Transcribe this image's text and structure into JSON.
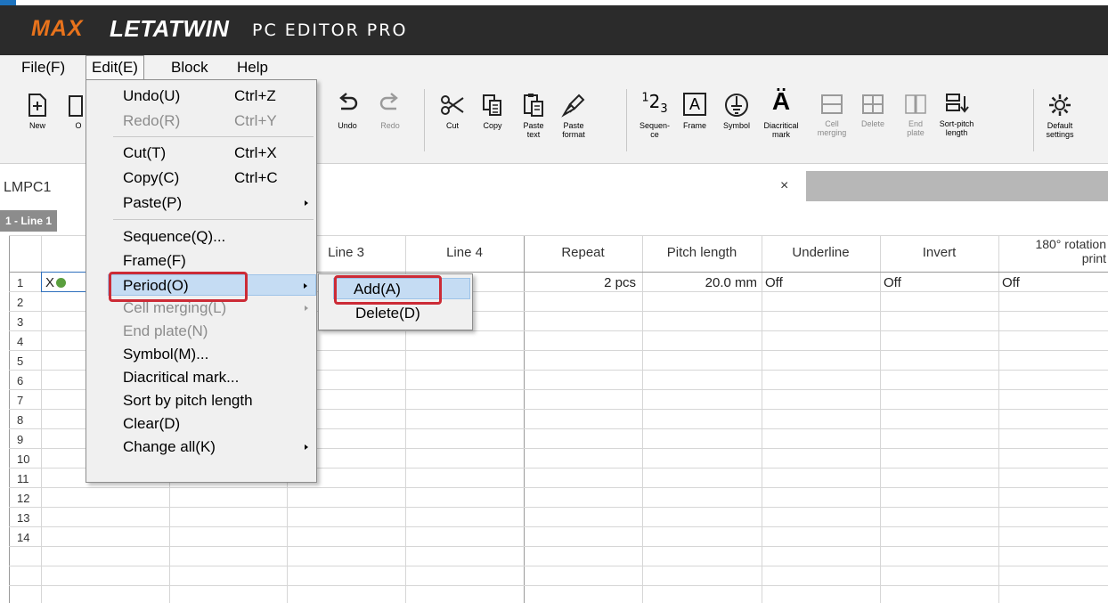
{
  "app": {
    "logo_max": "MAX",
    "logo_letatwin": "LETATWIN",
    "logo_subtitle": "PC EDITOR PRO"
  },
  "menubar": {
    "items": [
      "File(F)",
      "Edit(E)",
      "Block",
      "Help"
    ]
  },
  "toolbar": {
    "new": "New",
    "open_partial": "O",
    "undo": "Undo",
    "redo": "Redo",
    "cut": "Cut",
    "copy": "Copy",
    "paste_text_1": "Paste",
    "paste_text_2": "text",
    "paste_format_1": "Paste",
    "paste_format_2": "format",
    "sequence_1": "Sequen-",
    "sequence_2": "ce",
    "frame": "Frame",
    "symbol": "Symbol",
    "diacritical_1": "Diacritical",
    "diacritical_2": "mark",
    "cell_merging_1": "Cell",
    "cell_merging_2": "merging",
    "delete": "Delete",
    "end_plate_1": "End",
    "end_plate_2": "plate",
    "sort_pitch_1": "Sort-pitch",
    "sort_pitch_2": "length",
    "default_settings_1": "Default",
    "default_settings_2": "settings",
    "sequence_glyph_a": "1",
    "sequence_glyph_b": "2",
    "sequence_glyph_c": "3",
    "frame_glyph": "A",
    "diacritical_glyph": "Ä"
  },
  "document": {
    "tab_name": "LMPC1",
    "close_glyph": "×",
    "sheet_tab": "1 - Line 1"
  },
  "grid": {
    "headers": {
      "line3": "Line 3",
      "line4": "Line 4",
      "repeat": "Repeat",
      "pitch_length": "Pitch length",
      "underline": "Underline",
      "invert": "Invert",
      "rotation_1": "180° rotation",
      "rotation_2": "print"
    },
    "row_numbers": [
      "1",
      "2",
      "3",
      "4",
      "5",
      "6",
      "7",
      "8",
      "9",
      "10",
      "11",
      "12",
      "13",
      "14"
    ],
    "row1": {
      "line1": "X",
      "repeat": "2 pcs",
      "pitch_length": "20.0 mm",
      "underline": "Off",
      "invert": "Off",
      "rotation": "Off"
    }
  },
  "edit_menu": {
    "undo": "Undo(U)",
    "undo_sc": "Ctrl+Z",
    "redo": "Redo(R)",
    "redo_sc": "Ctrl+Y",
    "cut": "Cut(T)",
    "cut_sc": "Ctrl+X",
    "copy": "Copy(C)",
    "copy_sc": "Ctrl+C",
    "paste": "Paste(P)",
    "sequence": "Sequence(Q)...",
    "frame": "Frame(F)",
    "period": "Period(O)",
    "cell_merging": "Cell merging(L)",
    "end_plate": "End plate(N)",
    "symbol": "Symbol(M)...",
    "diacritical": "Diacritical mark...",
    "sort_pitch": "Sort by pitch length",
    "clear": "Clear(D)",
    "change_all": "Change all(K)"
  },
  "period_submenu": {
    "add": "Add(A)",
    "delete": "Delete(D)"
  },
  "colors": {
    "highlight": "#c5dcf3",
    "annotation_red": "#cc2b36",
    "brand_orange": "#e8731c"
  }
}
